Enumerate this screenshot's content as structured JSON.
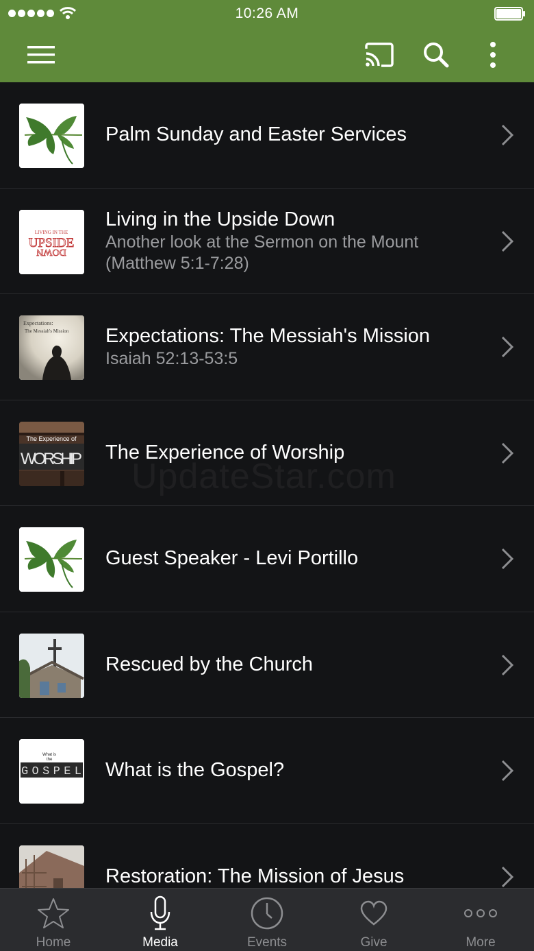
{
  "status_bar": {
    "time": "10:26 AM"
  },
  "toolbar": {
    "menu_icon": "hamburger-icon",
    "cast_icon": "cast-icon",
    "search_icon": "search-icon",
    "more_icon": "more-vertical-icon"
  },
  "list": {
    "items": [
      {
        "title": "Palm Sunday and Easter Services",
        "subtitle": "",
        "thumb": "leaf"
      },
      {
        "title": "Living in the Upside Down",
        "subtitle": "Another look at the Sermon on the Mount (Matthew 5:1-7:28)",
        "thumb": "upside-down",
        "thumb_text_top": "LIVING IN THE",
        "thumb_text_main": "UPSIDE",
        "thumb_text_bottom": "DOWN"
      },
      {
        "title": "Expectations: The Messiah's Mission",
        "subtitle": "Isaiah 52:13-53:5",
        "thumb": "expectations",
        "thumb_text_1": "Expectations:",
        "thumb_text_2": "The Messiah's Mission"
      },
      {
        "title": "The Experience of Worship",
        "subtitle": "",
        "thumb": "worship",
        "thumb_text_1": "The Experience of",
        "thumb_text_2": "WORSHIP"
      },
      {
        "title": "Guest Speaker - Levi Portillo",
        "subtitle": "",
        "thumb": "leaf"
      },
      {
        "title": "Rescued by the Church",
        "subtitle": "",
        "thumb": "church"
      },
      {
        "title": "What is the Gospel?",
        "subtitle": "",
        "thumb": "gospel",
        "thumb_text_1": "What is",
        "thumb_text_2": "the",
        "thumb_text_3": "GOSPEL"
      },
      {
        "title": "Restoration: The Mission of Jesus",
        "subtitle": "",
        "thumb": "restoration"
      }
    ]
  },
  "watermark": "UpdateStar.com",
  "tabs": [
    {
      "label": "Home",
      "icon": "star-icon",
      "active": false
    },
    {
      "label": "Media",
      "icon": "microphone-icon",
      "active": true
    },
    {
      "label": "Events",
      "icon": "clock-icon",
      "active": false
    },
    {
      "label": "Give",
      "icon": "heart-icon",
      "active": false
    },
    {
      "label": "More",
      "icon": "ellipsis-icon",
      "active": false
    }
  ],
  "colors": {
    "header_bg": "#5f8a3a",
    "list_bg": "#131416",
    "tabbar_bg": "#2b2c2f",
    "subtitle": "#9a9b9e"
  }
}
